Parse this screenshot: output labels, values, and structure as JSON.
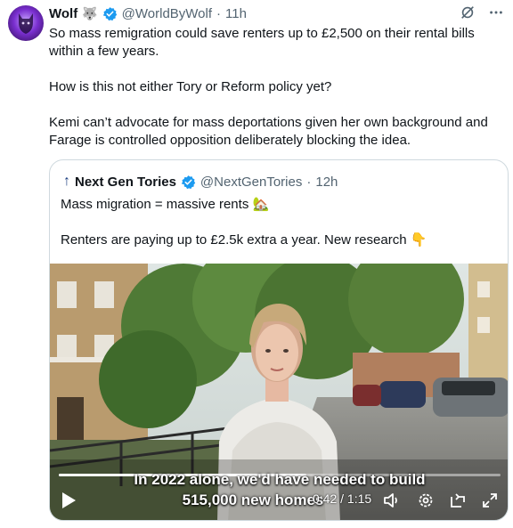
{
  "tweet": {
    "author_name": "Wolf",
    "author_emoji": "🐺",
    "handle": "@WorldByWolf",
    "separator": "·",
    "time": "11h",
    "paragraphs": [
      "So mass remigration could save renters up to £2,500 on their rental bills within a few years.",
      "How is this not either Tory or Reform policy yet?",
      "Kemi can’t advocate for mass deportations given her own background and Farage is controlled opposition deliberately blocking the idea."
    ]
  },
  "quoted": {
    "arrow": "↑",
    "author_name": "Next Gen Tories",
    "handle": "@NextGenTories",
    "separator": "·",
    "time": "12h",
    "paragraphs": [
      "Mass migration = massive rents 🏡",
      "Renters are paying up to £2.5k extra a year. New research 👇"
    ]
  },
  "video": {
    "caption_line1": "In 2022 alone, we'd have needed to build",
    "caption_line2": "515,000 new homes",
    "time_display": "0:42 / 1:15",
    "progress": 0.56
  },
  "icons": {
    "grok": "grok-slash-icon",
    "more": "more-options-icon",
    "play": "play-icon",
    "volume": "volume-icon",
    "settings": "settings-icon",
    "popout": "popout-icon",
    "fullscreen": "fullscreen-icon"
  },
  "colors": {
    "verified": "#1d9bf0",
    "secondary_text": "#536471",
    "border": "#cfd9de"
  }
}
